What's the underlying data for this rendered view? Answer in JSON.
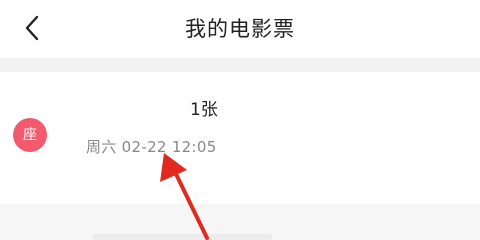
{
  "header": {
    "title": "我的电影票",
    "back_icon": "chevron-left-icon"
  },
  "ticket": {
    "seat_badge": "座",
    "count": "1张",
    "show_time": "周六 02-22 12:05"
  },
  "colors": {
    "badge": "#f25b6e",
    "annotation_arrow": "#e02a1f"
  }
}
